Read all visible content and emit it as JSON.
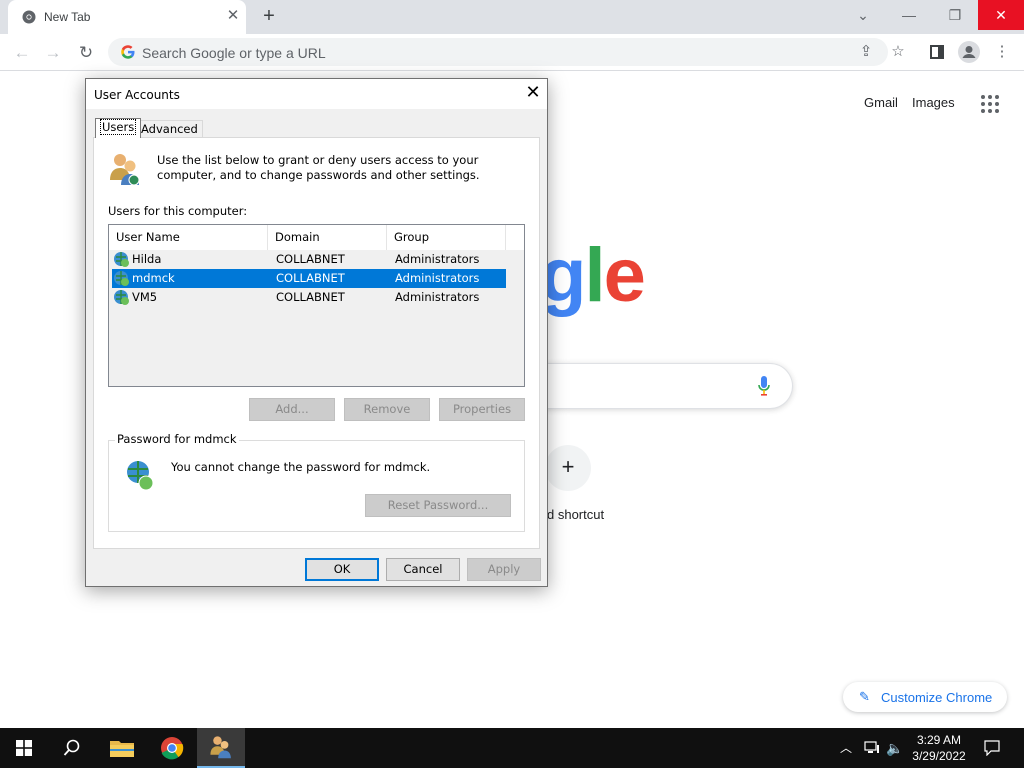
{
  "browser": {
    "tab_title": "New Tab",
    "omnibox_placeholder": "Search Google or type a URL"
  },
  "ntp": {
    "gmail": "Gmail",
    "images": "Images",
    "add_shortcut": "d shortcut",
    "customize": "Customize Chrome",
    "logo_letters": [
      "g",
      "l",
      "e"
    ]
  },
  "dialog": {
    "title": "User Accounts",
    "tabs": [
      "Users",
      "Advanced"
    ],
    "intro": "Use the list below to grant or deny users access to your computer, and to change passwords and other settings.",
    "list_label": "Users for this computer:",
    "columns": [
      "User Name",
      "Domain",
      "Group"
    ],
    "rows": [
      {
        "name": "Hilda",
        "domain": "COLLABNET",
        "group": "Administrators",
        "selected": false
      },
      {
        "name": "mdmck",
        "domain": "COLLABNET",
        "group": "Administrators",
        "selected": true
      },
      {
        "name": "VM5",
        "domain": "COLLABNET",
        "group": "Administrators",
        "selected": false
      }
    ],
    "buttons": {
      "add": "Add...",
      "remove": "Remove",
      "properties": "Properties"
    },
    "password_group": "Password for mdmck",
    "password_msg": "You cannot change the password for mdmck.",
    "reset_password": "Reset Password...",
    "ok": "OK",
    "cancel": "Cancel",
    "apply": "Apply"
  },
  "taskbar": {
    "time": "3:29 AM",
    "date": "3/29/2022"
  },
  "colors": {
    "selection": "#0078d7",
    "google_blue": "#4285f4",
    "google_green": "#34a853",
    "google_red": "#ea4335",
    "win_close": "#e81123"
  }
}
